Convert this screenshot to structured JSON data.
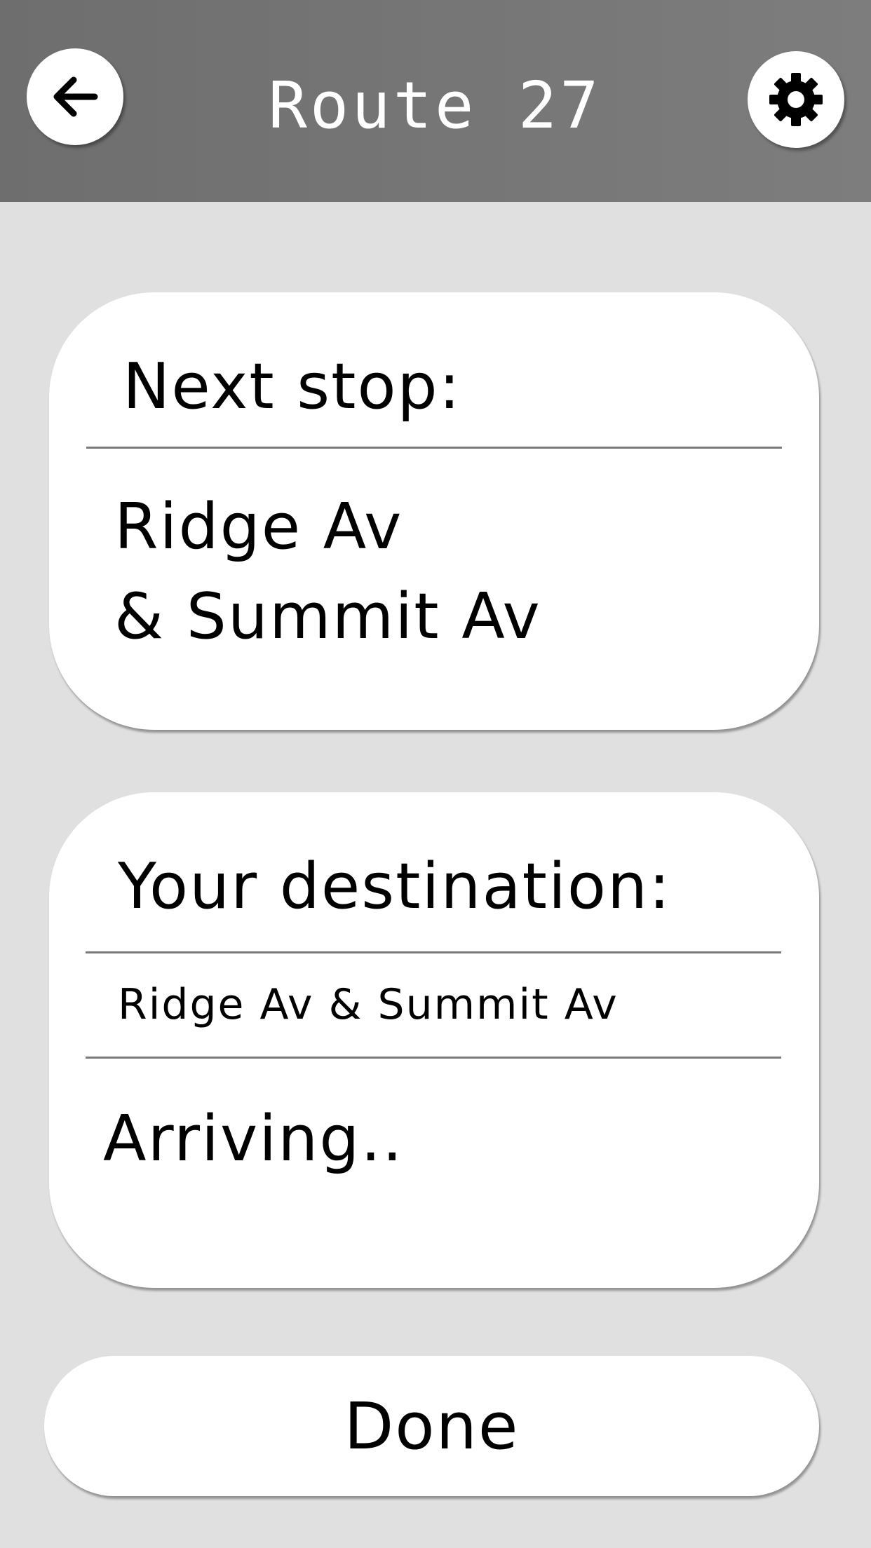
{
  "header": {
    "title": "Route 27",
    "back_icon": "arrow-left-icon",
    "settings_icon": "gear-icon",
    "background_color": "#777777"
  },
  "next_stop": {
    "label": "Next stop:",
    "line1": "Ridge Av",
    "line2": "& Summit Av"
  },
  "destination": {
    "label": "Your destination:",
    "value": "Ridge Av & Summit Av",
    "status": "Arriving.."
  },
  "done_button": {
    "label": "Done"
  },
  "colors": {
    "page_background": "#e0e0e0",
    "card_background": "#ffffff"
  }
}
